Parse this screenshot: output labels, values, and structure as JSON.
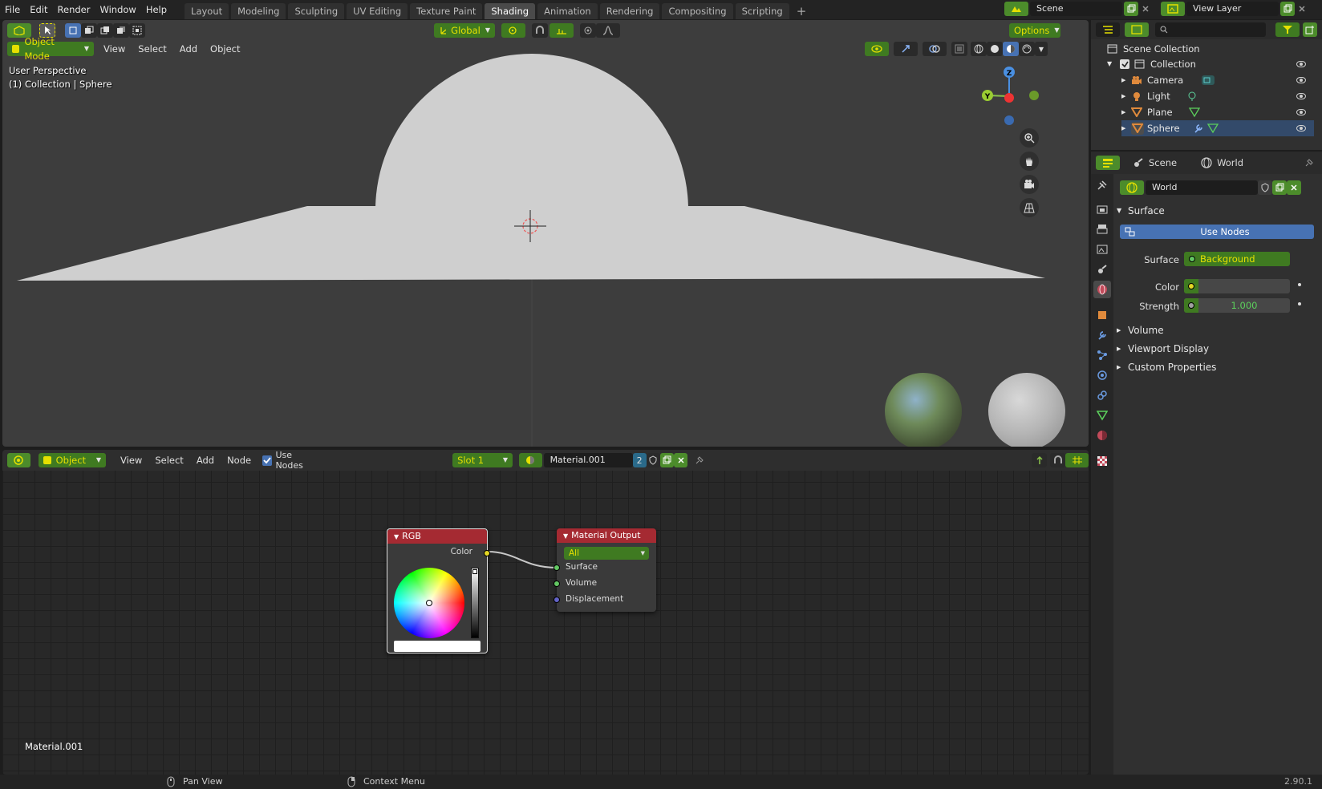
{
  "topbar": {
    "menus": [
      "File",
      "Edit",
      "Render",
      "Window",
      "Help"
    ],
    "workspaces": [
      "Layout",
      "Modeling",
      "Sculpting",
      "UV Editing",
      "Texture Paint",
      "Shading",
      "Animation",
      "Rendering",
      "Compositing",
      "Scripting"
    ],
    "active_workspace": "Shading",
    "scene": "Scene",
    "view_layer": "View Layer"
  },
  "viewport": {
    "transform_orientation": "Global",
    "options_label": "Options",
    "mode": "Object Mode",
    "menus": [
      "View",
      "Select",
      "Add",
      "Object"
    ],
    "overlay_title": "User Perspective",
    "overlay_subtitle": "(1) Collection | Sphere",
    "gizmo_axes": {
      "z": "Z",
      "y": "Y"
    }
  },
  "node_editor": {
    "object_type": "Object",
    "menus": [
      "View",
      "Select",
      "Add",
      "Node"
    ],
    "use_nodes_label": "Use Nodes",
    "slot": "Slot 1",
    "material": "Material.001",
    "users": "2",
    "material_label_bottom": "Material.001",
    "rgb_node": {
      "title": "RGB",
      "output": "Color"
    },
    "output_node": {
      "title": "Material Output",
      "target": "All",
      "inputs": [
        "Surface",
        "Volume",
        "Displacement"
      ]
    }
  },
  "outliner": {
    "root": "Scene Collection",
    "collection": "Collection",
    "items": [
      {
        "name": "Camera",
        "icon": "camera-icon"
      },
      {
        "name": "Light",
        "icon": "light-icon"
      },
      {
        "name": "Plane",
        "icon": "mesh-icon"
      },
      {
        "name": "Sphere",
        "icon": "mesh-icon"
      }
    ]
  },
  "properties": {
    "breadcrumb_scene": "Scene",
    "breadcrumb_world": "World",
    "world_name": "World",
    "surface_panel": "Surface",
    "use_nodes_button": "Use Nodes",
    "surface_label": "Surface",
    "surface_value": "Background",
    "color_label": "Color",
    "strength_label": "Strength",
    "strength_value": "1.000",
    "collapsed_panels": [
      "Volume",
      "Viewport Display",
      "Custom Properties"
    ]
  },
  "statusbar": {
    "hint1": "Pan View",
    "hint2": "Context Menu",
    "version": "2.90.1"
  },
  "colors": {
    "accent_green": "#4c8c2b",
    "accent_blue": "#4772b3",
    "node_header_red": "#a52a32"
  }
}
